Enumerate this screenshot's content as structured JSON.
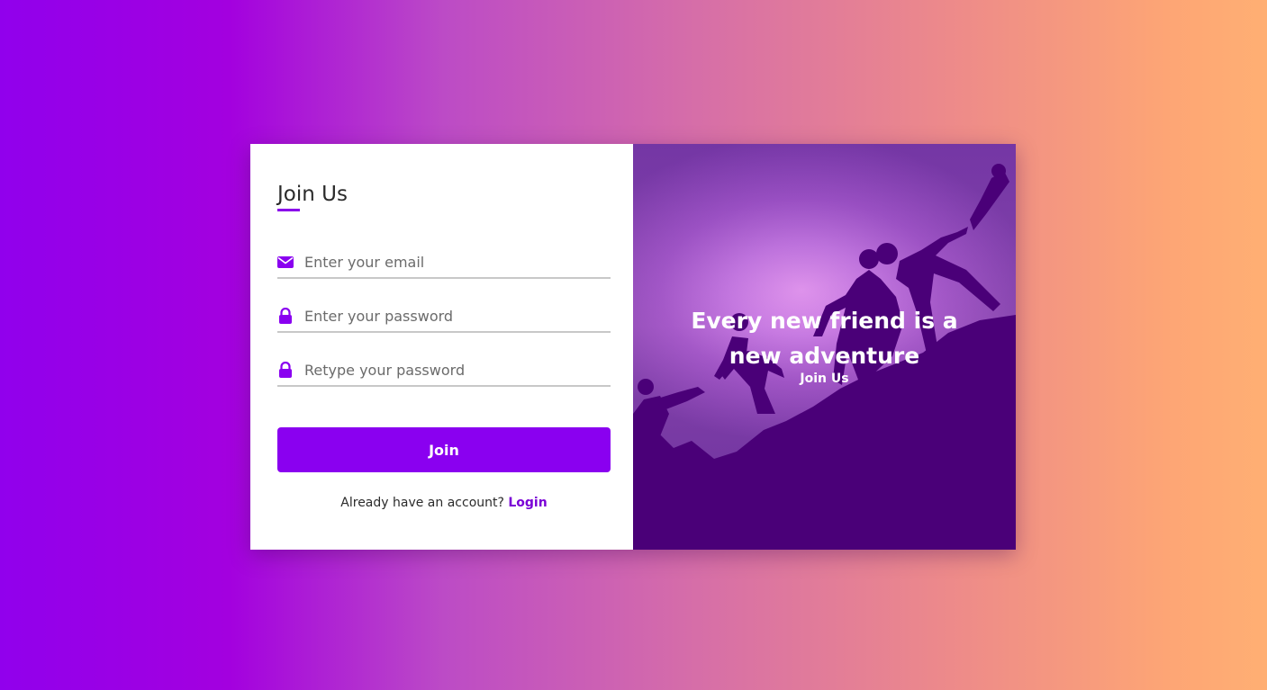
{
  "form": {
    "title": "Join Us",
    "email_placeholder": "Enter your email",
    "password_placeholder": "Enter your password",
    "retype_placeholder": "Retype your password",
    "submit_label": "Join",
    "account_prompt": "Already have an account?",
    "login_link": "Login"
  },
  "hero": {
    "title": "Every new friend is a new adventure",
    "subtitle": "Join Us"
  },
  "icons": {
    "email": "envelope-icon",
    "password": "lock-icon",
    "retype": "lock-icon"
  },
  "colors": {
    "accent": "#8a00f0",
    "link": "#7a00d6",
    "silhouette": "#4a0078"
  }
}
